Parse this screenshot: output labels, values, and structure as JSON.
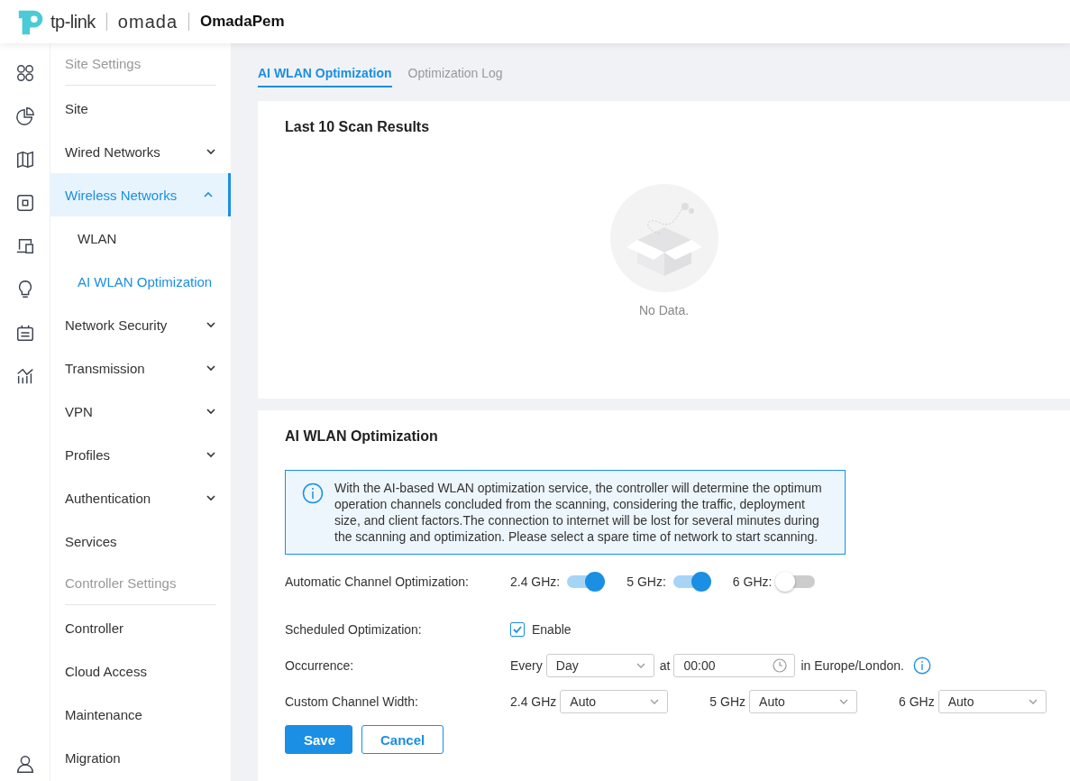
{
  "header": {
    "brand": "tp-link",
    "product": "omada",
    "site": "OmadaPem"
  },
  "sidebar": {
    "sections": [
      {
        "title": "Site Settings",
        "items": [
          {
            "label": "Site",
            "selected": false
          },
          {
            "label": "Wired Networks",
            "selected": false,
            "expanded": false
          },
          {
            "label": "Wireless Networks",
            "selected": true,
            "expanded": true,
            "children": [
              {
                "label": "WLAN",
                "selected": false
              },
              {
                "label": "AI WLAN Optimization",
                "selected": true
              }
            ]
          },
          {
            "label": "Network Security",
            "selected": false,
            "expanded": false
          },
          {
            "label": "Transmission",
            "selected": false,
            "expanded": false
          },
          {
            "label": "VPN",
            "selected": false,
            "expanded": false
          },
          {
            "label": "Profiles",
            "selected": false,
            "expanded": false
          },
          {
            "label": "Authentication",
            "selected": false,
            "expanded": false
          },
          {
            "label": "Services",
            "selected": false
          }
        ]
      },
      {
        "title": "Controller Settings",
        "items": [
          {
            "label": "Controller",
            "selected": false
          },
          {
            "label": "Cloud Access",
            "selected": false
          },
          {
            "label": "Maintenance",
            "selected": false
          },
          {
            "label": "Migration",
            "selected": false
          }
        ]
      }
    ]
  },
  "tabs": [
    {
      "label": "AI WLAN Optimization",
      "selected": true
    },
    {
      "label": "Optimization Log",
      "selected": false
    }
  ],
  "scan_card": {
    "title": "Last 10 Scan Results",
    "empty_text": "No Data."
  },
  "optimization_card": {
    "title": "AI WLAN Optimization",
    "info": "With the AI-based WLAN optimization service, the controller will determine the optimum operation channels concluded from the scanning, considering the traffic, deployment size, and client factors.The connection to internet will be lost for several minutes during the scanning and optimization. Please select a spare time of network to start scanning.",
    "auto_label": "Automatic Channel Optimization:",
    "bands": [
      {
        "label": "2.4 GHz:",
        "on": true
      },
      {
        "label": "5 GHz:",
        "on": true
      },
      {
        "label": "6 GHz:",
        "on": false
      }
    ],
    "scheduled_label": "Scheduled Optimization:",
    "enable": {
      "label": "Enable",
      "checked": true
    },
    "occurrence_label": "Occurrence:",
    "every": "Every",
    "day": "Day",
    "at": "at",
    "time": "00:00",
    "timezone": "in Europe/London.",
    "width_label": "Custom Channel Width:",
    "widths": [
      {
        "label": "2.4 GHz",
        "value": "Auto"
      },
      {
        "label": "5 GHz",
        "value": "Auto"
      },
      {
        "label": "6 GHz",
        "value": "Auto"
      }
    ],
    "buttons": {
      "save": "Save",
      "cancel": "Cancel"
    }
  }
}
